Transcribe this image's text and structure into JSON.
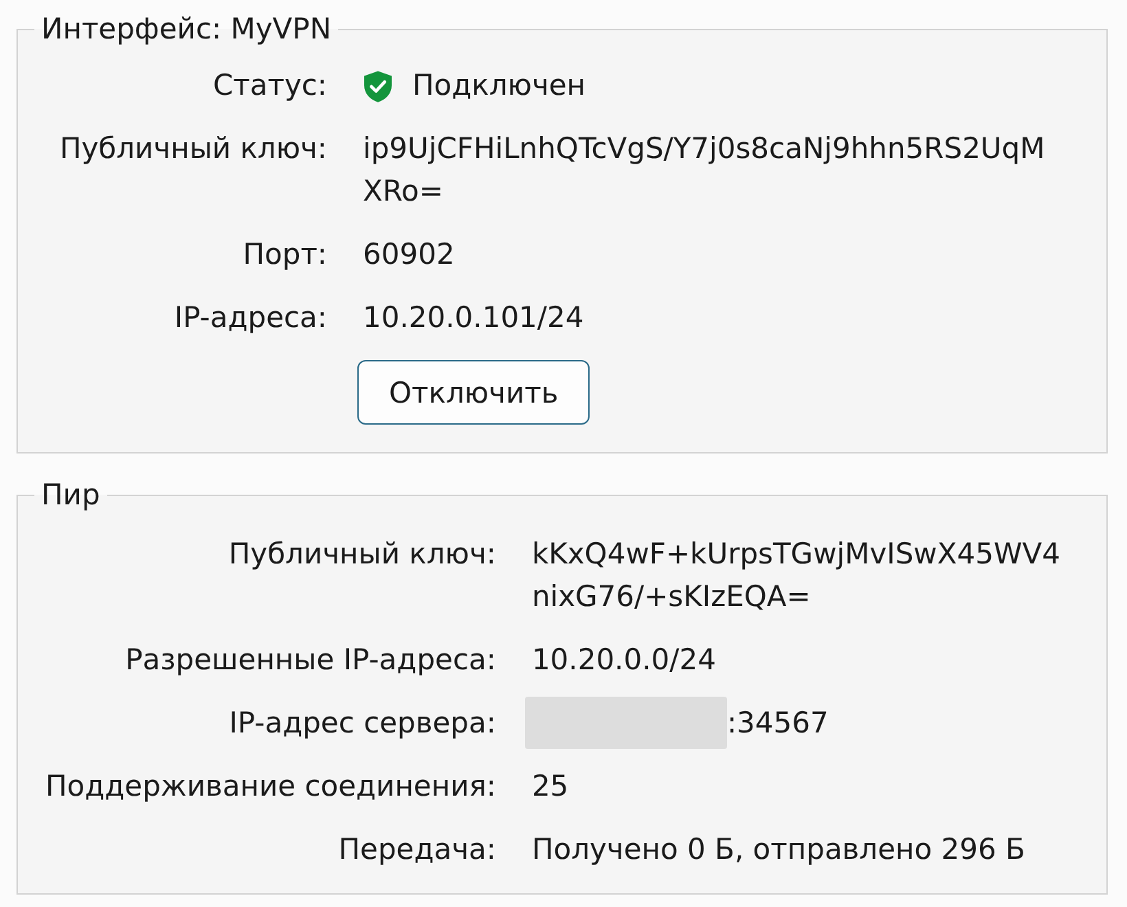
{
  "interface": {
    "title": "Интерфейс: MyVPN",
    "fields": [
      {
        "kind": "status",
        "label": "Статус:",
        "lines": [
          "Подключен"
        ]
      },
      {
        "kind": "text",
        "label": "Публичный ключ:",
        "lines": [
          "ip9UjCFHiLnhQTcVgS/Y7j0s8caNj9hhn5RS2UqM",
          "XRo="
        ]
      },
      {
        "kind": "text",
        "label": "Порт:",
        "lines": [
          "60902"
        ]
      },
      {
        "kind": "text",
        "label": "IP-адреса:",
        "lines": [
          "10.20.0.101/24"
        ]
      }
    ],
    "button": "Отключить"
  },
  "peer": {
    "title": "Пир",
    "fields": [
      {
        "kind": "text",
        "label": "Публичный ключ:",
        "lines": [
          "kKxQ4wF+kUrpsTGwjMvISwX45WV4",
          "nixG76/+sKIzEQA="
        ]
      },
      {
        "kind": "text",
        "label": "Разрешенные IP-адреса:",
        "lines": [
          "10.20.0.0/24"
        ]
      },
      {
        "kind": "masked",
        "label": "IP-адрес сервера:",
        "lines": [
          ":34567"
        ]
      },
      {
        "kind": "text",
        "label": "Поддерживание соединения:",
        "lines": [
          "25"
        ]
      },
      {
        "kind": "text",
        "label": "Передача:",
        "lines": [
          "Получено 0 Б, отправлено 296 Б"
        ]
      }
    ]
  }
}
